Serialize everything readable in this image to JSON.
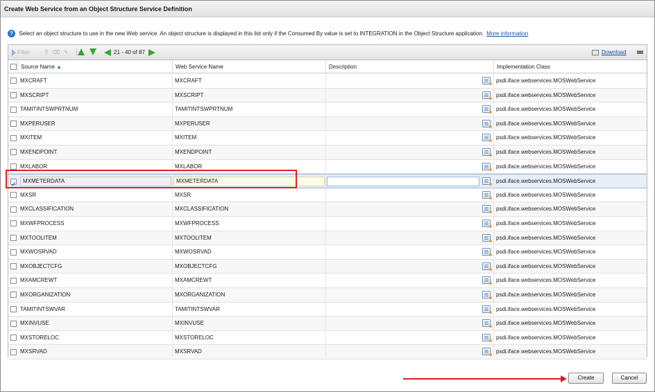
{
  "dialog": {
    "title": "Create Web Service from an Object Structure Service Definition",
    "info_text": "Select an object structure to use in the new Web service. An object structure is displayed in this list only if the Consumed By value is set to INTEGRATION in the Object Structure application.",
    "info_link": "More information"
  },
  "toolbar": {
    "filter_label": "Filter",
    "pagination": "21 - 40 of 87",
    "download_label": "Download"
  },
  "columns": {
    "source_name": "Source Name",
    "web_service_name": "Web Service Name",
    "description": "Description",
    "implementation_class": "Implementation Class"
  },
  "rows": [
    {
      "source": "MXCRAFT",
      "ws": "MXCRAFT",
      "impl": "psdi.iface.webservices.MOSWebService",
      "selected": false
    },
    {
      "source": "MXSCRIPT",
      "ws": "MXSCRIPT",
      "impl": "psdi.iface.webservices.MOSWebService",
      "selected": false
    },
    {
      "source": "TAMITINTSWPRTNUM",
      "ws": "TAMITINTSWPRTNUM",
      "impl": "psdi.iface.webservices.MOSWebService",
      "selected": false
    },
    {
      "source": "MXPERUSER",
      "ws": "MXPERUSER",
      "impl": "psdi.iface.webservices.MOSWebService",
      "selected": false
    },
    {
      "source": "MXITEM",
      "ws": "MXITEM",
      "impl": "psdi.iface.webservices.MOSWebService",
      "selected": false
    },
    {
      "source": "MXENDPOINT",
      "ws": "MXENDPOINT",
      "impl": "psdi.iface.webservices.MOSWebService",
      "selected": false
    },
    {
      "source": "MXLABOR",
      "ws": "MXLABOR",
      "impl": "psdi.iface.webservices.MOSWebService",
      "selected": false
    },
    {
      "source": "MXMETERDATA",
      "ws": "MXMETERDATA",
      "impl": "psdi.iface.webservices.MOSWebService",
      "selected": true
    },
    {
      "source": "MXSR",
      "ws": "MXSR",
      "impl": "psdi.iface.webservices.MOSWebService",
      "selected": false
    },
    {
      "source": "MXCLASSIFICATION",
      "ws": "MXCLASSIFICATION",
      "impl": "psdi.iface.webservices.MOSWebService",
      "selected": false
    },
    {
      "source": "MXWFPROCESS",
      "ws": "MXWFPROCESS",
      "impl": "psdi.iface.webservices.MOSWebService",
      "selected": false
    },
    {
      "source": "MXTOOLITEM",
      "ws": "MXTOOLITEM",
      "impl": "psdi.iface.webservices.MOSWebService",
      "selected": false
    },
    {
      "source": "MXWOSRVAD",
      "ws": "MXWOSRVAD",
      "impl": "psdi.iface.webservices.MOSWebService",
      "selected": false
    },
    {
      "source": "MXOBJECTCFG",
      "ws": "MXOBJECTCFG",
      "impl": "psdi.iface.webservices.MOSWebService",
      "selected": false
    },
    {
      "source": "MXAMCREWT",
      "ws": "MXAMCREWT",
      "impl": "psdi.iface.webservices.MOSWebService",
      "selected": false
    },
    {
      "source": "MXORGANIZATION",
      "ws": "MXORGANIZATION",
      "impl": "psdi.iface.webservices.MOSWebService",
      "selected": false
    },
    {
      "source": "TAMITINTSWVAR",
      "ws": "TAMITINTSWVAR",
      "impl": "psdi.iface.webservices.MOSWebService",
      "selected": false
    },
    {
      "source": "MXINVUSE",
      "ws": "MXINVUSE",
      "impl": "psdi.iface.webservices.MOSWebService",
      "selected": false
    },
    {
      "source": "MXSTORELOC",
      "ws": "MXSTORELOC",
      "impl": "psdi.iface.webservices.MOSWebService",
      "selected": false
    },
    {
      "source": "MXSRVAD",
      "ws": "MXSRVAD",
      "impl": "psdi.iface.webservices.MOSWebService",
      "selected": false
    }
  ],
  "buttons": {
    "create": "Create",
    "cancel": "Cancel"
  },
  "colors": {
    "highlight": "#e02020",
    "link": "#1b4fa3",
    "nav_arrow": "#3aa33a"
  }
}
